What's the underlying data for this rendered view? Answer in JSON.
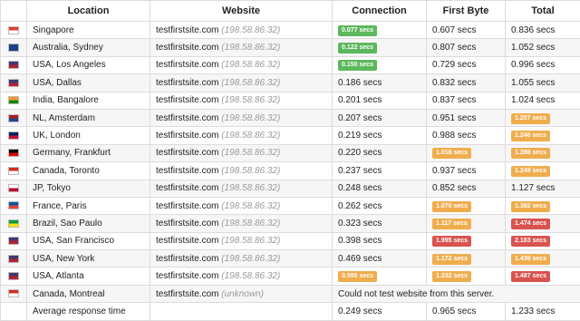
{
  "headers": {
    "location": "Location",
    "website": "Website",
    "connection": "Connection",
    "first_byte": "First Byte",
    "total": "Total"
  },
  "rows": [
    {
      "flag": "singapore-flag-icon",
      "flag_colors": [
        "#e03c31",
        "#ffffff"
      ],
      "location": "Singapore",
      "site": "testfirstsite.com",
      "ip": "(198.58.86.32)",
      "connection": {
        "text": "0.077 secs",
        "badge": "green"
      },
      "first_byte": {
        "text": "0.607 secs",
        "badge": ""
      },
      "total": {
        "text": "0.836 secs",
        "badge": ""
      }
    },
    {
      "flag": "australia-flag-icon",
      "flag_colors": [
        "#1f3d8a",
        "#1f3d8a"
      ],
      "location": "Australia, Sydney",
      "site": "testfirstsite.com",
      "ip": "(198.58.86.32)",
      "connection": {
        "text": "0.122 secs",
        "badge": "green"
      },
      "first_byte": {
        "text": "0.807 secs",
        "badge": ""
      },
      "total": {
        "text": "1.052 secs",
        "badge": ""
      }
    },
    {
      "flag": "usa-flag-icon",
      "flag_colors": [
        "#3c3b6e",
        "#b22234"
      ],
      "location": "USA, Los Angeles",
      "site": "testfirstsite.com",
      "ip": "(198.58.86.32)",
      "connection": {
        "text": "0.150 secs",
        "badge": "green"
      },
      "first_byte": {
        "text": "0.729 secs",
        "badge": ""
      },
      "total": {
        "text": "0.996 secs",
        "badge": ""
      }
    },
    {
      "flag": "usa-flag-icon",
      "flag_colors": [
        "#3c3b6e",
        "#b22234"
      ],
      "location": "USA, Dallas",
      "site": "testfirstsite.com",
      "ip": "(198.58.86.32)",
      "connection": {
        "text": "0.186 secs",
        "badge": ""
      },
      "first_byte": {
        "text": "0.832 secs",
        "badge": ""
      },
      "total": {
        "text": "1.055 secs",
        "badge": ""
      }
    },
    {
      "flag": "india-flag-icon",
      "flag_colors": [
        "#ff9933",
        "#138808"
      ],
      "location": "India, Bangalore",
      "site": "testfirstsite.com",
      "ip": "(198.58.86.32)",
      "connection": {
        "text": "0.201 secs",
        "badge": ""
      },
      "first_byte": {
        "text": "0.837 secs",
        "badge": ""
      },
      "total": {
        "text": "1.024 secs",
        "badge": ""
      }
    },
    {
      "flag": "netherlands-flag-icon",
      "flag_colors": [
        "#ae1c28",
        "#21468b"
      ],
      "location": "NL, Amsterdam",
      "site": "testfirstsite.com",
      "ip": "(198.58.86.32)",
      "connection": {
        "text": "0.207 secs",
        "badge": ""
      },
      "first_byte": {
        "text": "0.951 secs",
        "badge": ""
      },
      "total": {
        "text": "1.207 secs",
        "badge": "orange"
      }
    },
    {
      "flag": "uk-flag-icon",
      "flag_colors": [
        "#012169",
        "#c8102e"
      ],
      "location": "UK, London",
      "site": "testfirstsite.com",
      "ip": "(198.58.86.32)",
      "connection": {
        "text": "0.219 secs",
        "badge": ""
      },
      "first_byte": {
        "text": "0.988 secs",
        "badge": ""
      },
      "total": {
        "text": "1.246 secs",
        "badge": "orange"
      }
    },
    {
      "flag": "germany-flag-icon",
      "flag_colors": [
        "#000000",
        "#dd0000"
      ],
      "location": "Germany, Frankfurt",
      "site": "testfirstsite.com",
      "ip": "(198.58.86.32)",
      "connection": {
        "text": "0.220 secs",
        "badge": ""
      },
      "first_byte": {
        "text": "1.018 secs",
        "badge": "orange"
      },
      "total": {
        "text": "1.288 secs",
        "badge": "orange"
      }
    },
    {
      "flag": "canada-flag-icon",
      "flag_colors": [
        "#d52b1e",
        "#ffffff"
      ],
      "location": "Canada, Toronto",
      "site": "testfirstsite.com",
      "ip": "(198.58.86.32)",
      "connection": {
        "text": "0.237 secs",
        "badge": ""
      },
      "first_byte": {
        "text": "0.937 secs",
        "badge": ""
      },
      "total": {
        "text": "1.249 secs",
        "badge": "orange"
      }
    },
    {
      "flag": "japan-flag-icon",
      "flag_colors": [
        "#ffffff",
        "#bc002d"
      ],
      "location": "JP, Tokyo",
      "site": "testfirstsite.com",
      "ip": "(198.58.86.32)",
      "connection": {
        "text": "0.248 secs",
        "badge": ""
      },
      "first_byte": {
        "text": "0.852 secs",
        "badge": ""
      },
      "total": {
        "text": "1.127 secs",
        "badge": ""
      }
    },
    {
      "flag": "france-flag-icon",
      "flag_colors": [
        "#0055a4",
        "#ef4135"
      ],
      "location": "France, Paris",
      "site": "testfirstsite.com",
      "ip": "(198.58.86.32)",
      "connection": {
        "text": "0.262 secs",
        "badge": ""
      },
      "first_byte": {
        "text": "1.070 secs",
        "badge": "orange"
      },
      "total": {
        "text": "1.382 secs",
        "badge": "orange"
      }
    },
    {
      "flag": "brazil-flag-icon",
      "flag_colors": [
        "#009c3b",
        "#ffdf00"
      ],
      "location": "Brazil, Sao Paulo",
      "site": "testfirstsite.com",
      "ip": "(198.58.86.32)",
      "connection": {
        "text": "0.323 secs",
        "badge": ""
      },
      "first_byte": {
        "text": "1.117 secs",
        "badge": "orange"
      },
      "total": {
        "text": "1.474 secs",
        "badge": "red"
      }
    },
    {
      "flag": "usa-flag-icon",
      "flag_colors": [
        "#3c3b6e",
        "#b22234"
      ],
      "location": "USA, San Francisco",
      "site": "testfirstsite.com",
      "ip": "(198.58.86.32)",
      "connection": {
        "text": "0.398 secs",
        "badge": ""
      },
      "first_byte": {
        "text": "1.995 secs",
        "badge": "red"
      },
      "total": {
        "text": "2.183 secs",
        "badge": "red"
      }
    },
    {
      "flag": "usa-flag-icon",
      "flag_colors": [
        "#3c3b6e",
        "#b22234"
      ],
      "location": "USA, New York",
      "site": "testfirstsite.com",
      "ip": "(198.58.86.32)",
      "connection": {
        "text": "0.469 secs",
        "badge": ""
      },
      "first_byte": {
        "text": "1.172 secs",
        "badge": "orange"
      },
      "total": {
        "text": "1.439 secs",
        "badge": "orange"
      }
    },
    {
      "flag": "usa-flag-icon",
      "flag_colors": [
        "#3c3b6e",
        "#b22234"
      ],
      "location": "USA, Atlanta",
      "site": "testfirstsite.com",
      "ip": "(198.58.86.32)",
      "connection": {
        "text": "0.595 secs",
        "badge": "orange"
      },
      "first_byte": {
        "text": "1.232 secs",
        "badge": "orange"
      },
      "total": {
        "text": "1.487 secs",
        "badge": "red"
      }
    }
  ],
  "failed_row": {
    "flag": "canada-flag-icon",
    "flag_colors": [
      "#d52b1e",
      "#ffffff"
    ],
    "location": "Canada, Montreal",
    "site": "testfirstsite.com",
    "ip": "(unknown)",
    "message": "Could not test website from this server."
  },
  "summary": {
    "label": "Average response time",
    "connection": "0.249 secs",
    "first_byte": "0.965 secs",
    "total": "1.233 secs"
  },
  "badge_colors": {
    "green": "#5cb85c",
    "orange": "#f0ad4e",
    "red": "#d9534f"
  }
}
